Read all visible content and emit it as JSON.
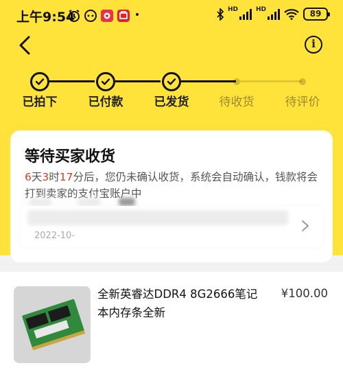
{
  "status_bar": {
    "time": "上午9:54",
    "hd1": "HD",
    "hd2": "HD",
    "battery": "89"
  },
  "nav": {
    "back_icon": "chevron-left-icon",
    "info_icon": "info-icon",
    "info_glyph": "i"
  },
  "progress": {
    "steps": [
      {
        "label": "已拍下",
        "done": true
      },
      {
        "label": "已付款",
        "done": true
      },
      {
        "label": "已发货",
        "done": true
      },
      {
        "label": "待收货",
        "done": false
      },
      {
        "label": "待评价",
        "done": false
      }
    ]
  },
  "card": {
    "title": "等待买家收货",
    "countdown_days": "6",
    "unit_days": "天",
    "countdown_hours": "3",
    "unit_hours": "时",
    "countdown_minutes": "17",
    "unit_minutes_suffix": "分后，您仍未确认收货，系统会自动确认，钱款将会打到卖家的支付宝账户中",
    "logistics_date": "2022-10-"
  },
  "product": {
    "title": "全新英睿达DDR4 8G2666笔记本内存条全新",
    "price": "¥100.00"
  },
  "colors": {
    "accent_yellow": "#ffe33a",
    "countdown_red": "#e03a1e"
  }
}
